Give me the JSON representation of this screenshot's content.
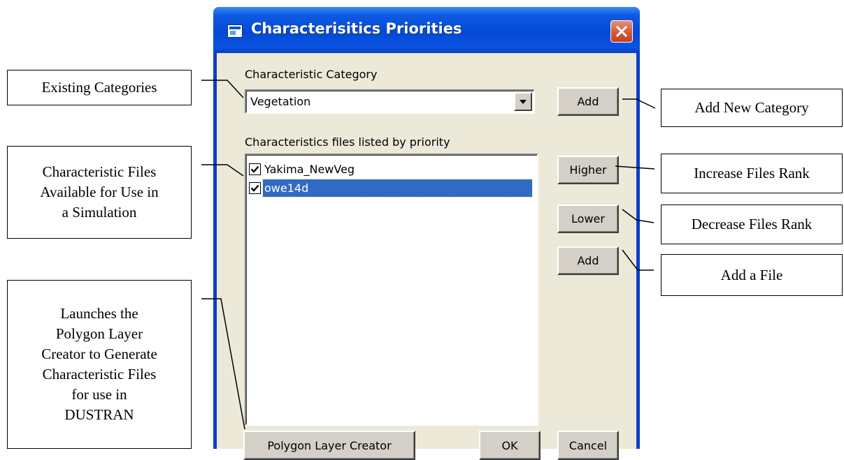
{
  "window": {
    "title": "Characterisitics Priorities",
    "category_label": "Characteristic Category",
    "category_value": "Vegetation",
    "add_category_label": "Add",
    "files_label": "Characteristics files listed by priority",
    "files": [
      {
        "name": "Yakima_NewVeg",
        "checked": true,
        "selected": false
      },
      {
        "name": "owe14d",
        "checked": true,
        "selected": true
      }
    ],
    "higher_label": "Higher",
    "lower_label": "Lower",
    "add_file_label": "Add",
    "polygon_label": "Polygon Layer Creator",
    "ok_label": "OK",
    "cancel_label": "Cancel"
  },
  "callouts": {
    "existing_categories": "Existing Categories",
    "characteristic_files": "Characteristic Files\nAvailable for Use in\na Simulation",
    "launches": "Launches the\nPolygon Layer\nCreator to Generate\nCharacteristic Files\nfor use in\nDUSTRAN",
    "add_new_category": "Add New Category",
    "increase_rank": "Increase Files Rank",
    "decrease_rank": "Decrease Files Rank",
    "add_file": "Add a File"
  },
  "colors": {
    "titlebar": "#0449d6",
    "dialog_face": "#ece9d8",
    "selection": "#316ac5",
    "close_button": "#d65d3e"
  },
  "icons": {
    "title": "window-app-icon",
    "close": "close-icon",
    "dropdown": "chevron-down-icon",
    "check": "checkmark-icon"
  }
}
